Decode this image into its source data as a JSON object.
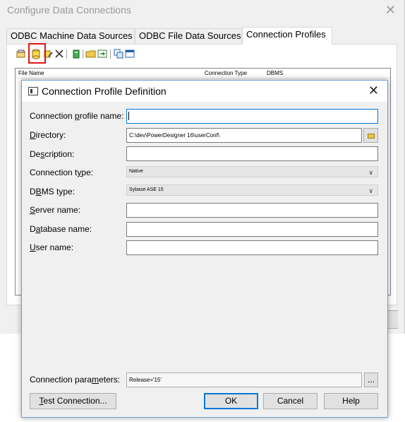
{
  "outer": {
    "title": "Configure Data Connections",
    "tabs": [
      {
        "label": "ODBC Machine Data Sources"
      },
      {
        "label": "ODBC File Data Sources"
      },
      {
        "label": "Connection Profiles"
      }
    ],
    "toolbar_icons": [
      "properties-icon",
      "add-connection-profile-icon",
      "edit-connection-profile-icon",
      "delete-icon",
      "database-icon",
      "open-folder-icon",
      "export-icon",
      "copy-icon",
      "window-icon"
    ],
    "list_columns": [
      "File Name",
      "Connection Type",
      "DBMS"
    ]
  },
  "dialog": {
    "title": "Connection Profile Definition",
    "fields": {
      "profile_name": {
        "label_pre": "Connection ",
        "label_key": "p",
        "label_post": "rofile name:",
        "value": ""
      },
      "directory": {
        "label_pre": "",
        "label_key": "D",
        "label_post": "irectory:",
        "value": "C:\\dev\\PowerDesigner 16\\userConf\\"
      },
      "description": {
        "label_pre": "De",
        "label_key": "s",
        "label_post": "cription:",
        "value": ""
      },
      "connection_type": {
        "label_pre": "Connection t",
        "label_key": "y",
        "label_post": "pe:",
        "value": "Native"
      },
      "dbms_type": {
        "label_pre": "D",
        "label_key": "B",
        "label_post": "MS type:",
        "value": "Sybase ASE 15"
      },
      "server_name": {
        "label_pre": "",
        "label_key": "S",
        "label_post": "erver name:",
        "value": ""
      },
      "database_name": {
        "label_pre": "D",
        "label_key": "a",
        "label_post": "tabase name:",
        "value": ""
      },
      "user_name": {
        "label_pre": "",
        "label_key": "U",
        "label_post": "ser name:",
        "value": ""
      },
      "connection_parameters": {
        "label_pre": "Connection para",
        "label_key": "m",
        "label_post": "eters:",
        "value": "Release='15'"
      }
    },
    "params_button": "...",
    "buttons": {
      "test_pre": "",
      "test_key": "T",
      "test_post": "est Connection...",
      "ok": "OK",
      "cancel": "Cancel",
      "help": "Help"
    }
  }
}
